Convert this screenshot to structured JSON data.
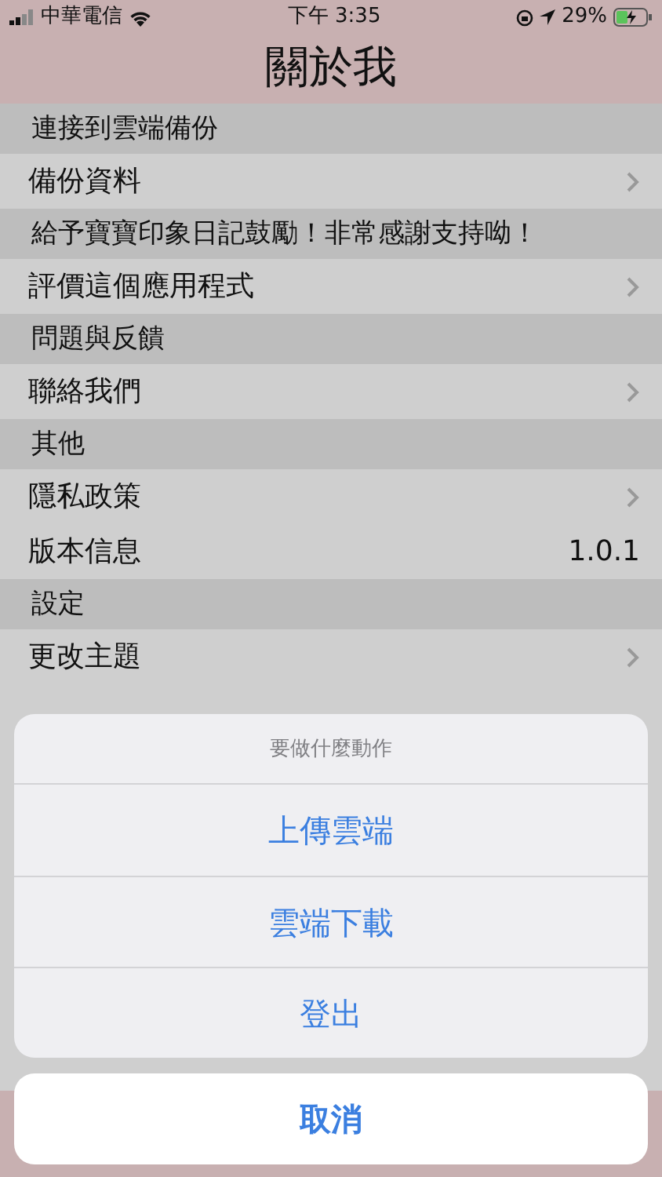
{
  "status_bar": {
    "carrier": "中華電信",
    "time": "下午 3:35",
    "battery": "29%"
  },
  "nav": {
    "title": "關於我"
  },
  "sections": [
    {
      "header": "連接到雲端備份",
      "rows": [
        {
          "label": "備份資料",
          "kind": "link"
        }
      ]
    },
    {
      "header": "給予寶寶印象日記鼓勵！非常感謝支持呦！",
      "rows": [
        {
          "label": "評價這個應用程式",
          "kind": "link"
        }
      ]
    },
    {
      "header": "問題與反饋",
      "rows": [
        {
          "label": "聯絡我們",
          "kind": "link"
        }
      ]
    },
    {
      "header": "其他",
      "rows": [
        {
          "label": "隱私政策",
          "kind": "link"
        },
        {
          "label": "版本信息",
          "kind": "value",
          "value": "1.0.1"
        }
      ]
    },
    {
      "header": "設定",
      "rows": [
        {
          "label": "更改主題",
          "kind": "link"
        }
      ]
    }
  ],
  "action_sheet": {
    "title": "要做什麼動作",
    "actions": [
      "上傳雲端",
      "雲端下載",
      "登出"
    ],
    "cancel": "取消"
  }
}
